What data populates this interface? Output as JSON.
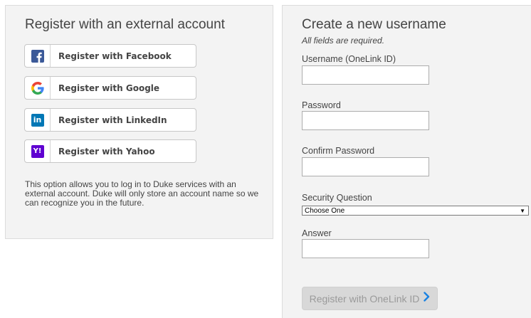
{
  "external": {
    "title": "Register with an external account",
    "buttons": [
      {
        "label": "Register with Facebook",
        "icon": "facebook-icon",
        "color": "#3b5998"
      },
      {
        "label": "Register with Google",
        "icon": "google-icon",
        "color": "#4285f4"
      },
      {
        "label": "Register with LinkedIn",
        "icon": "linkedin-icon",
        "color": "#0077b5"
      },
      {
        "label": "Register with Yahoo",
        "icon": "yahoo-icon",
        "color": "#5f01d1"
      }
    ],
    "info": "This option allows you to log in to Duke services with an external account. Duke will only store an account name so we can recognize you in the future."
  },
  "create": {
    "title": "Create a new username",
    "subtitle": "All fields are required.",
    "username_label": "Username (OneLink ID)",
    "username_value": "",
    "password_label": "Password",
    "password_value": "",
    "confirm_label": "Confirm Password",
    "confirm_value": "",
    "security_label": "Security Question",
    "security_selected": "Choose One",
    "answer_label": "Answer",
    "answer_value": "",
    "submit_label": "Register with OneLink ID"
  },
  "colors": {
    "panel_bg": "#f3f3f3",
    "accent": "#1a82e2"
  }
}
